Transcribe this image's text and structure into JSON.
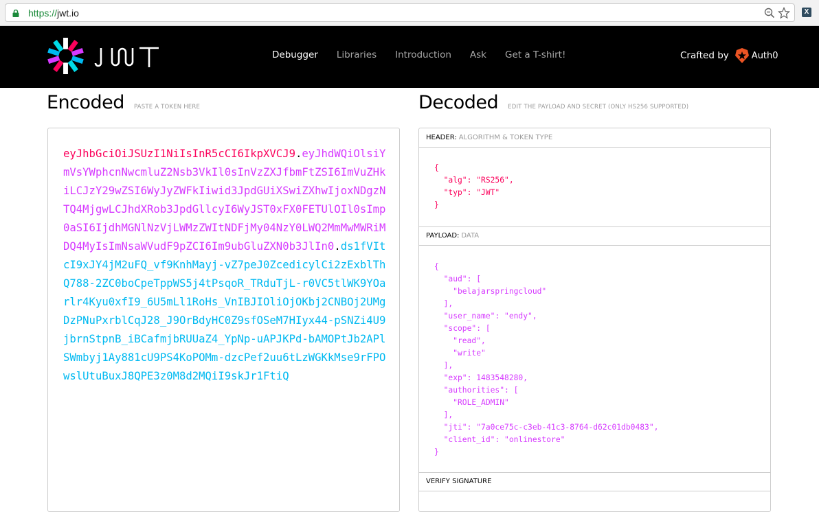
{
  "browser": {
    "url_scheme": "https://",
    "url_host": "jwt.io",
    "extension_label": "X"
  },
  "nav": {
    "logo_text": "JWT",
    "links": [
      {
        "label": "Debugger",
        "active": true
      },
      {
        "label": "Libraries",
        "active": false
      },
      {
        "label": "Introduction",
        "active": false
      },
      {
        "label": "Ask",
        "active": false
      },
      {
        "label": "Get a T-shirt!",
        "active": false
      }
    ],
    "crafted_by": "Crafted by",
    "brand": "Auth0"
  },
  "encoded": {
    "title": "Encoded",
    "hint": "PASTE A TOKEN HERE",
    "token": {
      "header": "eyJhbGciOiJSUzI1NiIsInR5cCI6IkpXVCJ9",
      "payload": "eyJhdWQiOlsiYmVsYWphcnNwcmluZ2Nsb3VkIl0sInVzZXJfbmFtZSI6ImVuZHkiLCJzY29wZSI6WyJyZWFkIiwid3JpdGUiXSwiZXhwIjoxNDgzNTQ4MjgwLCJhdXRob3JpdGllcyI6WyJST0xFX0FETUlOIl0sImp0aSI6IjdhMGNlNzVjLWMzZWItNDFjMy04NzY0LWQ2MmMwMWRiMDQ4MyIsImNsaWVudF9pZCI6Im9ubGluZXN0b3JlIn0",
      "signature": "ds1fVItcI9xJY4jM2uFQ_vf9KnhMayj-vZ7peJ0ZcedicylCi2zExblThQ788-2ZC0boCpeTppWS5j4tPsqoR_TRduTjL-r0VC5tlWK9YOarlr4Kyu0xfI9_6U5mLl1RoHs_VnIBJIOliOjOKbj2CNBOj2UMgDzPNuPxrblCqJ28_J9OrBdyHC0Z9sfOSeM7HIyx44-pSNZi4U9jbrnStpnB_iBCafmjbRUUaZ4_YpNp-uAPJKPd-bAMOPtJb2APlSWmbyj1Ay881cU9PS4KoPOMm-dzcPef2uu6tLzWGKkMse9rFPOwslUtuBuxJ8QPE3z0M8d2MQiI9skJr1FtiQ",
      "separator": "."
    }
  },
  "decoded": {
    "title": "Decoded",
    "hint": "EDIT THE PAYLOAD AND SECRET (ONLY HS256 SUPPORTED)",
    "header_section": {
      "label": "HEADER:",
      "sublabel": "ALGORITHM & TOKEN TYPE",
      "json": "{\n  \"alg\": \"RS256\",\n  \"typ\": \"JWT\"\n}"
    },
    "payload_section": {
      "label": "PAYLOAD:",
      "sublabel": "DATA",
      "json": "{\n  \"aud\": [\n    \"belajarspringcloud\"\n  ],\n  \"user_name\": \"endy\",\n  \"scope\": [\n    \"read\",\n    \"write\"\n  ],\n  \"exp\": 1483548280,\n  \"authorities\": [\n    \"ROLE_ADMIN\"\n  ],\n  \"jti\": \"7a0ce75c-c3eb-41c3-8764-d62c01db0483\",\n  \"client_id\": \"onlinestore\"\n}"
    },
    "verify_section": {
      "label": "VERIFY SIGNATURE"
    }
  },
  "colors": {
    "header": "#fb015b",
    "payload": "#d63aff",
    "signature": "#00b9f1"
  }
}
